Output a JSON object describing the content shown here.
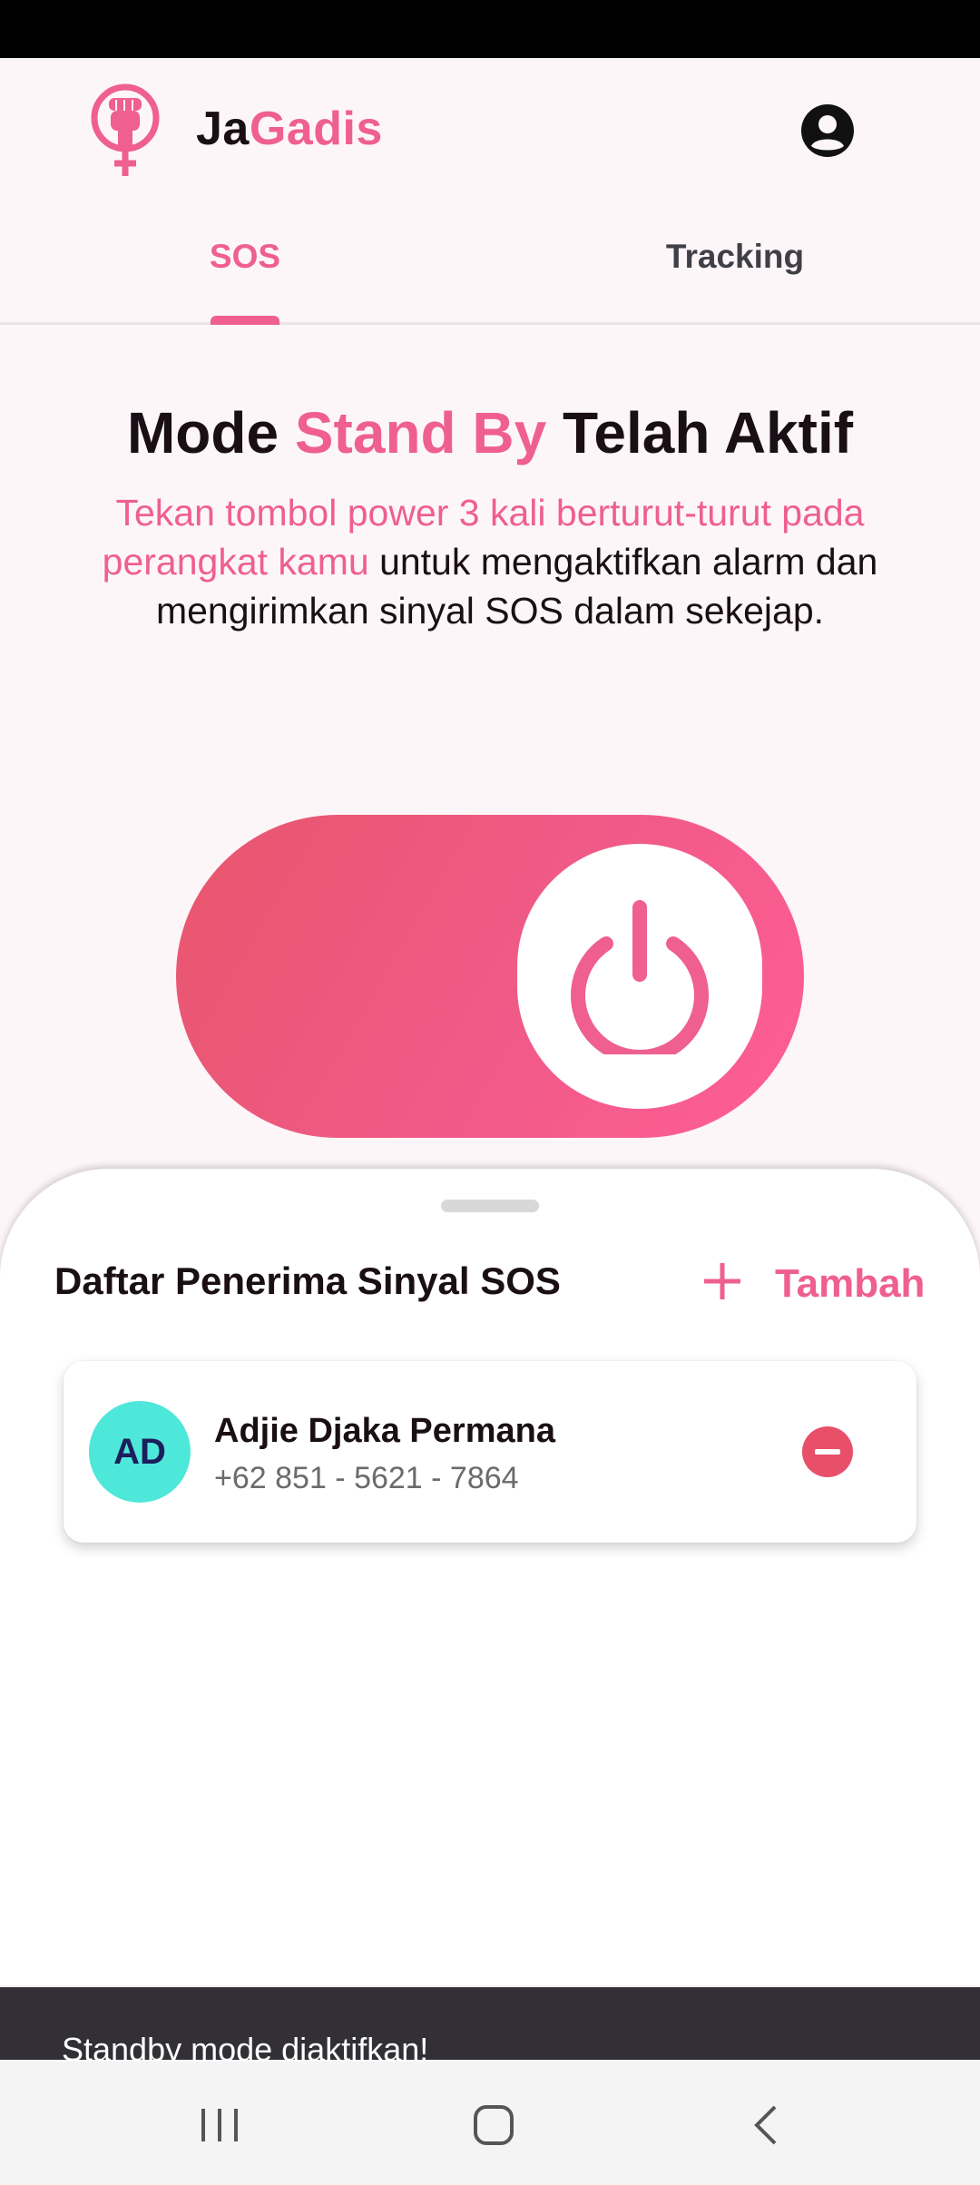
{
  "app": {
    "name_part1": "Ja",
    "name_part2": "Gadis",
    "logo_icon": "female-fist-icon",
    "profile_icon": "account-circle-icon"
  },
  "tabs": [
    {
      "label": "SOS",
      "active": true
    },
    {
      "label": "Tracking",
      "active": false
    }
  ],
  "headline": {
    "part1": "Mode ",
    "part2": "Stand By",
    "part3": " Telah Aktif"
  },
  "instruction": {
    "highlight": "Tekan tombol power 3 kali berturut-turut pada perangkat kamu",
    "rest": " untuk mengaktifkan alarm dan mengirimkan sinyal SOS dalam sekejap."
  },
  "sos_toggle": {
    "icon": "power-icon",
    "state": "on"
  },
  "recipients": {
    "title": "Daftar Penerima Sinyal SOS",
    "add_label": "Tambah",
    "add_icon": "plus-icon",
    "contacts": [
      {
        "initials": "AD",
        "name": "Adjie Djaka Permana",
        "phone": "+62 851 - 5621 - 7864",
        "remove_icon": "minus-circle-icon"
      }
    ]
  },
  "snackbar": {
    "message": "Standby mode diaktifkan!"
  },
  "colors": {
    "accent": "#ef5f90",
    "toggle_start": "#e8566c",
    "toggle_end": "#ff5e95",
    "avatar_bg": "#4de8d9",
    "remove": "#e8506a",
    "background": "#fdf6f9"
  }
}
